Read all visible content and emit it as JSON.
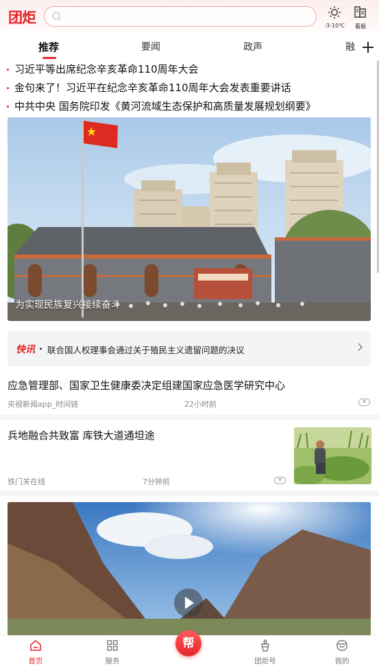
{
  "header": {
    "logo": "团炬",
    "search_placeholder": "",
    "weather_temp": "-3-10℃",
    "kanbao_label": "看报"
  },
  "tabs": [
    {
      "label": "推荐",
      "active": true
    },
    {
      "label": "要闻",
      "active": false
    },
    {
      "label": "政声",
      "active": false
    },
    {
      "label": "融",
      "active": false
    }
  ],
  "headlines": [
    "习近平等出席纪念辛亥革命110周年大会",
    "金句来了！习近平在纪念辛亥革命110周年大会发表重要讲话",
    "中共中央 国务院印发《黄河流域生态保护和高质量发展规划纲要》"
  ],
  "hero": {
    "caption": "为实现民族复兴接续奋斗"
  },
  "flash": {
    "tag": "快讯",
    "text": "联合国人权理事会通过关于殖民主义遗留问题的决议"
  },
  "news": [
    {
      "title": "应急管理部、国家卫生健康委决定组建国家应急医学研究中心",
      "source": "央视新闻app_时间链",
      "time": "22小时前"
    },
    {
      "title": "兵地融合共致富 库铁大道通坦途",
      "source": "铁门关在线",
      "time": "7分钟前"
    }
  ],
  "bottom_nav": [
    {
      "label": "首页",
      "icon": "home-icon",
      "active": true
    },
    {
      "label": "服务",
      "icon": "grid-icon",
      "active": false
    },
    {
      "label": "团炬号",
      "icon": "torch-icon",
      "active": false
    },
    {
      "label": "我的",
      "icon": "profile-icon",
      "active": false
    }
  ],
  "help_button": "帮",
  "colors": {
    "accent": "#e4262a"
  }
}
